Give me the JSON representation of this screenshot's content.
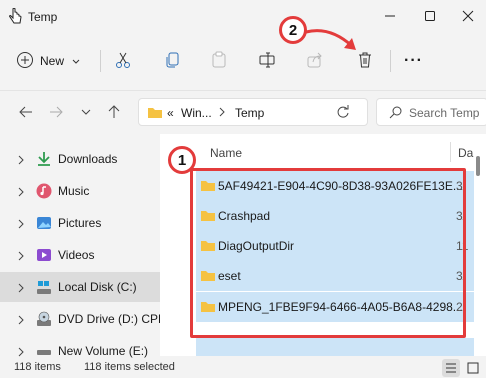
{
  "window": {
    "title": "Temp"
  },
  "toolbar": {
    "new_label": "New",
    "more_label": "···"
  },
  "address": {
    "overflow": "«",
    "crumbs": [
      "Win...",
      "Temp"
    ],
    "search_placeholder": "Search Temp"
  },
  "nav": {
    "items": [
      {
        "label": "Downloads",
        "icon": "download-icon"
      },
      {
        "label": "Music",
        "icon": "music-icon"
      },
      {
        "label": "Pictures",
        "icon": "pictures-icon"
      },
      {
        "label": "Videos",
        "icon": "videos-icon"
      },
      {
        "label": "Local Disk (C:)",
        "icon": "disk-icon"
      },
      {
        "label": "DVD Drive (D:) CPR",
        "icon": "dvd-icon"
      },
      {
        "label": "New Volume (E:)",
        "icon": "drive-icon"
      }
    ]
  },
  "columns": {
    "name": "Name",
    "date": "Da"
  },
  "files": [
    {
      "name": "5AF49421-E904-4C90-8D38-93A026FE13E...",
      "date": "3/"
    },
    {
      "name": "Crashpad",
      "date": "3/"
    },
    {
      "name": "DiagOutputDir",
      "date": "11"
    },
    {
      "name": "eset",
      "date": "3/"
    },
    {
      "name": "MPENG_1FBE9F94-6466-4A05-B6A8-4298...",
      "date": "2/"
    }
  ],
  "callouts": {
    "one": "1",
    "two": "2"
  },
  "status": {
    "count": "118 items",
    "selected": "118 items selected"
  },
  "colors": {
    "selection": "#cce4f7",
    "callout": "#e33b3b",
    "folder": "#f5c242"
  }
}
